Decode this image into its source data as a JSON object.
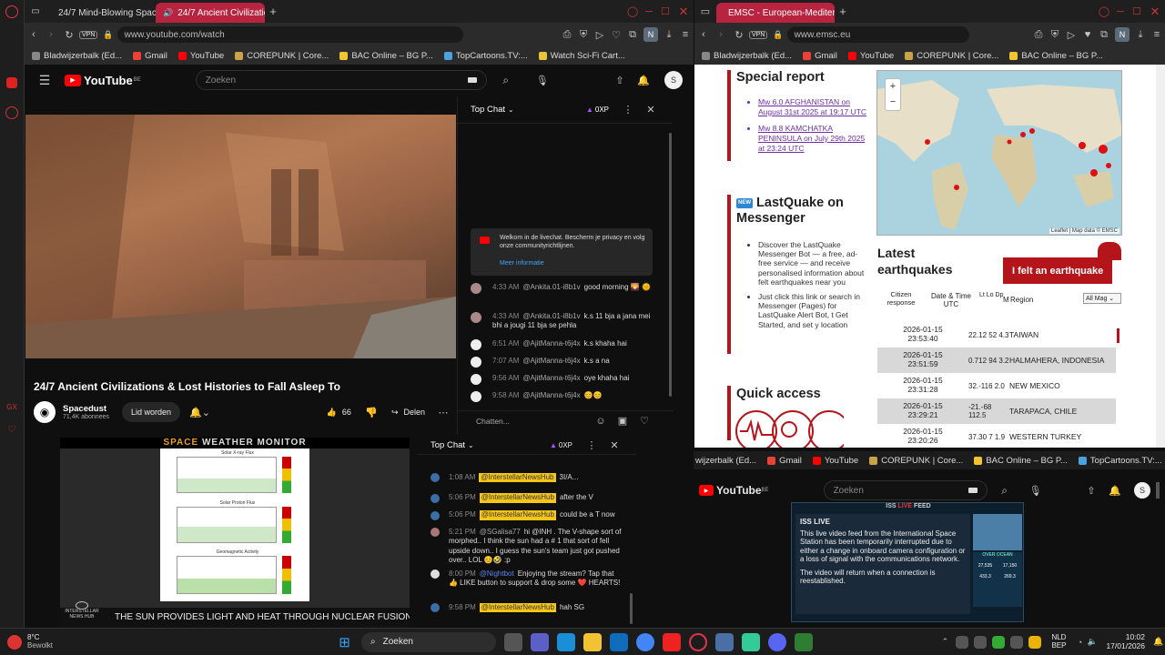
{
  "left_window": {
    "tabs": [
      {
        "label": "24/7 Mind-Blowing Space"
      },
      {
        "label": "24/7 Ancient Civilizatio"
      }
    ],
    "url": "www.youtube.com/watch",
    "bookmarks": [
      "Bladwijzerbalk (Ed...",
      "Gmail",
      "YouTube",
      "COREPUNK | Core...",
      "BAC Online – BG P...",
      "TopCartoons.TV:...",
      "Watch Sci-Fi Cart..."
    ],
    "youtube": {
      "logo": "YouTube",
      "country": "BE",
      "search_placeholder": "Zoeken",
      "avatar_letter": "S",
      "video_title": "24/7 Ancient Civilizations & Lost Histories to Fall Asleep To",
      "channel_name": "Spacedust",
      "subscribers": "71,4K abonnees",
      "join_label": "Lid worden",
      "likes": "66",
      "share_label": "Delen",
      "chat": {
        "header": "Top Chat",
        "points": "0XP",
        "welcome": "Welkom in de livechat. Bescherm je privacy en volg onze communityrichtlijnen.",
        "more_info": "Meer informatie",
        "messages": [
          {
            "time": "4:33 AM",
            "user": "@Ankita.01-i8b1v",
            "text": "good morning 🌄 🌞"
          },
          {
            "time": "4:33 AM",
            "user": "@Ankita.01-i8b1v",
            "text": "k.s 11 bja a jana mei bhi a jougi 11 bja se pehla"
          },
          {
            "time": "6:51 AM",
            "user": "@AjitManna-t6j4x",
            "text": "k.s khaha hai"
          },
          {
            "time": "7:07 AM",
            "user": "@AjitManna-t6j4x",
            "text": "k.s a na"
          },
          {
            "time": "9:56 AM",
            "user": "@AjitManna-t6j4x",
            "text": "oye khaha hai"
          },
          {
            "time": "9:58 AM",
            "user": "@AjitManna-t6j4x",
            "text": "😊😊"
          }
        ],
        "input_placeholder": "Chatten..."
      }
    }
  },
  "right_window": {
    "tab": "EMSC - European-Mediter",
    "url": "www.emsc.eu",
    "bookmarks": [
      "Bladwijzerbalk (Ed...",
      "Gmail",
      "YouTube",
      "COREPUNK | Core...",
      "BAC Online – BG P..."
    ],
    "special_report_title": "Special report",
    "special_links": [
      "Mw 6.0 AFGHANISTAN on August 31st 2025 at 19:17 UTC",
      "Mw 8.8 KAMCHATKA PENINSULA on July 29th 2025 at 23:24 UTC"
    ],
    "lastquake_badge": "NEW",
    "lastquake_title": "LastQuake on Messenger",
    "lastquake_items": [
      "Discover the LastQuake Messenger Bot — a free, ad-free service — and receive personalised information about felt earthquakes near you",
      "Just click this link or search in Messenger (Pages) for LastQuake Alert Bot, t Get Started, and set y location"
    ],
    "quick_access_title": "Quick access",
    "map_attribution": "Leaflet | Map data © EMSC",
    "latest_title": "Latest earthquakes",
    "felt_button": "I felt an earthquake",
    "table_headers": [
      "Citizen response",
      "Date & Time UTC",
      "Lt Lo Dp",
      "M",
      "Region",
      "All Mag"
    ],
    "quakes": [
      {
        "date": "2026-01-15",
        "time": "23:53:40",
        "vals": "22.12 52 4.3",
        "region": "TAIWAN"
      },
      {
        "date": "2026-01-15",
        "time": "23:51:59",
        "vals": "0.712 94 3.2",
        "region": "HALMAHERA, INDONESIA"
      },
      {
        "date": "2026-01-15",
        "time": "23:31:28",
        "vals": "32.-116 2.0",
        "region": "NEW MEXICO"
      },
      {
        "date": "2026-01-15",
        "time": "23:29:21",
        "vals": "-21.-68 112.5",
        "region": "TARAPACA, CHILE"
      },
      {
        "date": "2026-01-15",
        "time": "23:20:26",
        "vals": "37.30 7 1.9",
        "region": "WESTERN TURKEY"
      }
    ]
  },
  "bottom_left": {
    "title_space": "SPACE",
    "title_rest": "WEATHER MONITOR",
    "panels": [
      "Solar X-ray Flux",
      "Solar Proton Flux",
      "Geomagnetic Activity"
    ],
    "ticker": "THE SUN PROVIDES LIGHT AND HEAT THROUGH NUCLEAR FUSION",
    "logo_text": "INTERSTELLAR NEWS HUB"
  },
  "bottom_chat": {
    "header": "Top Chat",
    "points": "0XP",
    "messages": [
      {
        "time": "1:08 AM",
        "user": "@InterstellarNewsHub",
        "text": "3I/A..."
      },
      {
        "time": "5:06 PM",
        "user": "@InterstellarNewsHub",
        "text": "after the V"
      },
      {
        "time": "5:06 PM",
        "user": "@InterstellarNewsHub",
        "text": "could be a T now"
      },
      {
        "time": "5:21 PM",
        "user": "@SGalisa77",
        "text": "hi @INH . The V-shape sort of morphed.. I think the sun had a # 1 that sort of fell upside down.. I guess the sun's team just got pushed over.. LOL 😊🤣 :p"
      },
      {
        "time": "8:00 PM",
        "user": "@Nightbot",
        "text": "Enjoying the stream? Tap that 👍 LIKE button to support & drop some ❤️ HEARTS!"
      },
      {
        "time": "9:58 PM",
        "user": "@InterstellarNewsHub",
        "text": "hah SG"
      }
    ]
  },
  "bottom_right": {
    "bookmarks": [
      "wijzerbalk (Ed...",
      "Gmail",
      "YouTube",
      "COREPUNK | Core...",
      "BAC Online – BG P...",
      "TopCartoons.TV:..."
    ],
    "logo": "YouTube",
    "country": "BE",
    "search_placeholder": "Zoeken",
    "avatar_letter": "S",
    "iss_header_left": "ISS",
    "iss_header_live": "LIVE",
    "iss_header_right": "FEED",
    "iss_live": "ISS LIVE",
    "iss_msg1": "This live video feed from the International Space Station has been temporarily interrupted due to either a change in onboard camera configuration or a loss of signal with the communications network.",
    "iss_msg2": "The video will return when a connection is reestablished.",
    "iss_side_label": "OVER OCEAN",
    "iss_stats": [
      "27,535",
      "17,150",
      "433.3",
      "269.3"
    ]
  },
  "taskbar": {
    "weather_temp": "8°C",
    "weather_desc": "Bewolkt",
    "search_label": "Zoeken",
    "lang": "NLD",
    "lang2": "BEP",
    "time": "10:02",
    "date": "17/01/2026"
  },
  "colors": {
    "youtube_red": "#ff0000",
    "emsc_red": "#b3151b",
    "tab_active": "#b8233f"
  }
}
